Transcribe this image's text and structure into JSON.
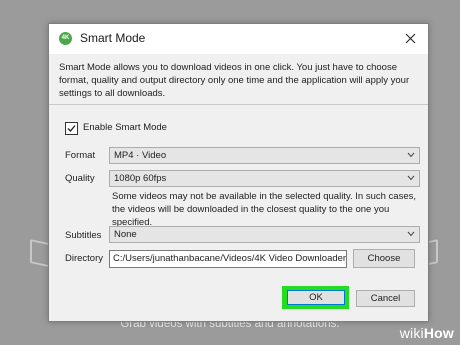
{
  "background": {
    "caption": "Grab videos with subtitles and annotations."
  },
  "dialog": {
    "title": "Smart Mode",
    "icon_text": "4K",
    "description": "Smart Mode allows you to download videos in one click. You just have to choose format, quality and output directory only one time and the application will apply your settings to all downloads.",
    "enable_checkbox": {
      "label": "Enable Smart Mode",
      "checked": true
    },
    "format": {
      "label": "Format",
      "value": "MP4 · Video"
    },
    "quality": {
      "label": "Quality",
      "value": "1080p 60fps"
    },
    "quality_note": "Some videos may not be available in the selected quality. In such cases, the videos will be downloaded in the closest quality to the one you specified.",
    "subtitles": {
      "label": "Subtitles",
      "value": "None"
    },
    "directory": {
      "label": "Directory",
      "value": "C:/Users/junathanbacane/Videos/4K Video Downloader",
      "choose_label": "Choose"
    },
    "buttons": {
      "ok": "OK",
      "cancel": "Cancel"
    }
  },
  "watermark": {
    "wiki": "wiki",
    "how": "How"
  },
  "colors": {
    "highlight": "#22dd22",
    "accent": "#0078d7",
    "icon_green": "#4aa84a"
  }
}
